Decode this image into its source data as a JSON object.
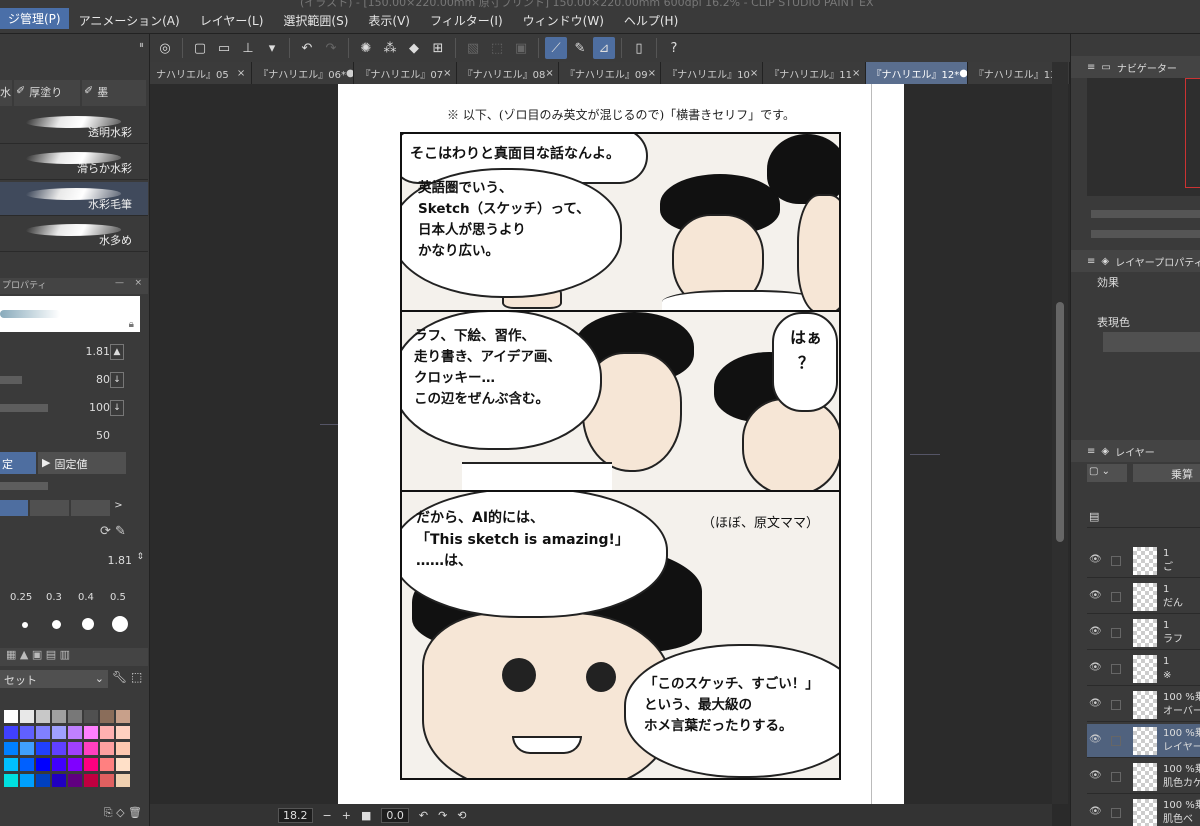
{
  "title_fragment": "(イラスト) - [150.00×220.00mm 原寸プリント] 150.00×220.00mm 600dpi 16.2% - CLIP STUDIO PAINT EX",
  "menu": {
    "items": [
      "ジ管理(P)",
      "アニメーション(A)",
      "レイヤー(L)",
      "選択範囲(S)",
      "表示(V)",
      "フィルター(I)",
      "ウィンドウ(W)",
      "ヘルプ(H)"
    ]
  },
  "tabs": [
    {
      "label": "ナハリエル』05",
      "close": "×"
    },
    {
      "label": "『ナハリエル』06*",
      "close": "●"
    },
    {
      "label": "『ナハリエル』07",
      "close": "×"
    },
    {
      "label": "『ナハリエル』08",
      "close": "×"
    },
    {
      "label": "『ナハリエル』09",
      "close": "×"
    },
    {
      "label": "『ナハリエル』10",
      "close": "×"
    },
    {
      "label": "『ナハリエル』11",
      "close": "×"
    },
    {
      "label": "『ナハリエル』12*",
      "close": "●"
    },
    {
      "label": "『ナハリエル』13",
      "close": "×"
    }
  ],
  "page": {
    "note": "※ 以下、(ゾロ目のみ英文が混じるので)「横書きセリフ」です。",
    "panel1": {
      "bubble1": "そこはわりと真面目な話なんよ。",
      "bubble2": "英語圏でいう、\nSketch（スケッチ）って、\n日本人が思うより\nかなり広い。"
    },
    "panel2": {
      "bubble1": "ラフ、下絵、習作、\n走り書き、アイデア画、\nクロッキー…\nこの辺をぜんぶ含む。",
      "bubble2": "はぁ\n？"
    },
    "panel3": {
      "bubble1": "だから、AI的には、\n「This sketch is amazing!」\n……は、",
      "note": "（ほぼ、原文ママ）",
      "bubble2": "「このスケッチ、すごい！」\nという、最大級の\nホメ言葉だったりする。"
    }
  },
  "status": {
    "zoom": "18.2",
    "angle": "0.0"
  },
  "left": {
    "tool_tabs": [
      "水",
      "厚塗り",
      "墨"
    ],
    "brushes": [
      "透明水彩",
      "滑らか水彩",
      "水彩毛筆",
      "水多め"
    ],
    "property_title": "プロパティ",
    "props": [
      {
        "value": "1.81"
      },
      {
        "value": "80"
      },
      {
        "value": "100"
      },
      {
        "value": "50"
      }
    ],
    "btn_fixed_left": "定",
    "btn_fixed": "固定値",
    "size_value": "1.81",
    "sizes": [
      "0.25",
      "0.3",
      "0.4",
      "0.5"
    ],
    "palette_label": "セット"
  },
  "right": {
    "navigator": "ナビゲーター",
    "layer_property": "レイヤープロパティ",
    "effect_label": "効果",
    "express_label": "表現色",
    "layer_panel": "レイヤー",
    "blend": "乗算",
    "layers": [
      {
        "line1": "1",
        "line2": "ご"
      },
      {
        "line1": "1",
        "line2": "だん"
      },
      {
        "line1": "1",
        "line2": "ラフ"
      },
      {
        "line1": "1",
        "line2": "※"
      },
      {
        "line1": "100 %乗",
        "line2": "オーバー"
      },
      {
        "line1": "100 %乗",
        "line2": "レイヤー"
      },
      {
        "line1": "100 %乗",
        "line2": "肌色カゲ"
      },
      {
        "line1": "100 %乗",
        "line2": "肌色ベ"
      },
      {
        "line1": "1",
        "line2": ""
      }
    ]
  }
}
